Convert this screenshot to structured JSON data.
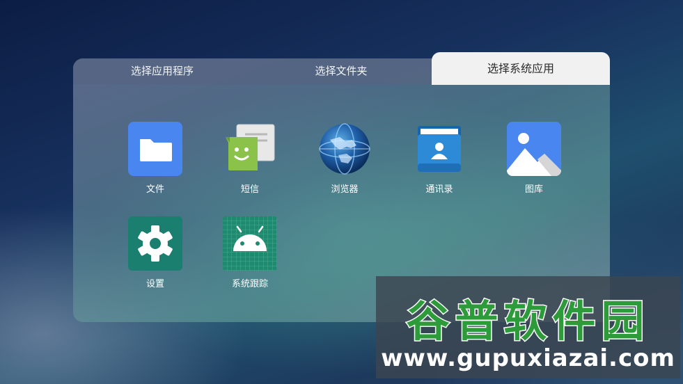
{
  "tabs": [
    {
      "label": "选择应用程序",
      "active": false
    },
    {
      "label": "选择文件夹",
      "active": false
    },
    {
      "label": "选择系统应用",
      "active": true
    }
  ],
  "apps": [
    {
      "label": "文件",
      "icon": "folder-icon",
      "color": "#4a86f0"
    },
    {
      "label": "短信",
      "icon": "messaging-icon",
      "color": "#8bc34a"
    },
    {
      "label": "浏览器",
      "icon": "browser-globe-icon",
      "color": "#1f5fa8"
    },
    {
      "label": "通讯录",
      "icon": "contacts-icon",
      "color": "#2d8ad6"
    },
    {
      "label": "图库",
      "icon": "gallery-icon",
      "color": "#4a86f0"
    },
    {
      "label": "设置",
      "icon": "gear-icon",
      "color": "#1a7f6e"
    },
    {
      "label": "系统跟踪",
      "icon": "android-icon",
      "color": "#1f8a6f"
    }
  ],
  "watermark": {
    "title": "谷普软件园",
    "url": "www.gupuxiazai.com"
  }
}
